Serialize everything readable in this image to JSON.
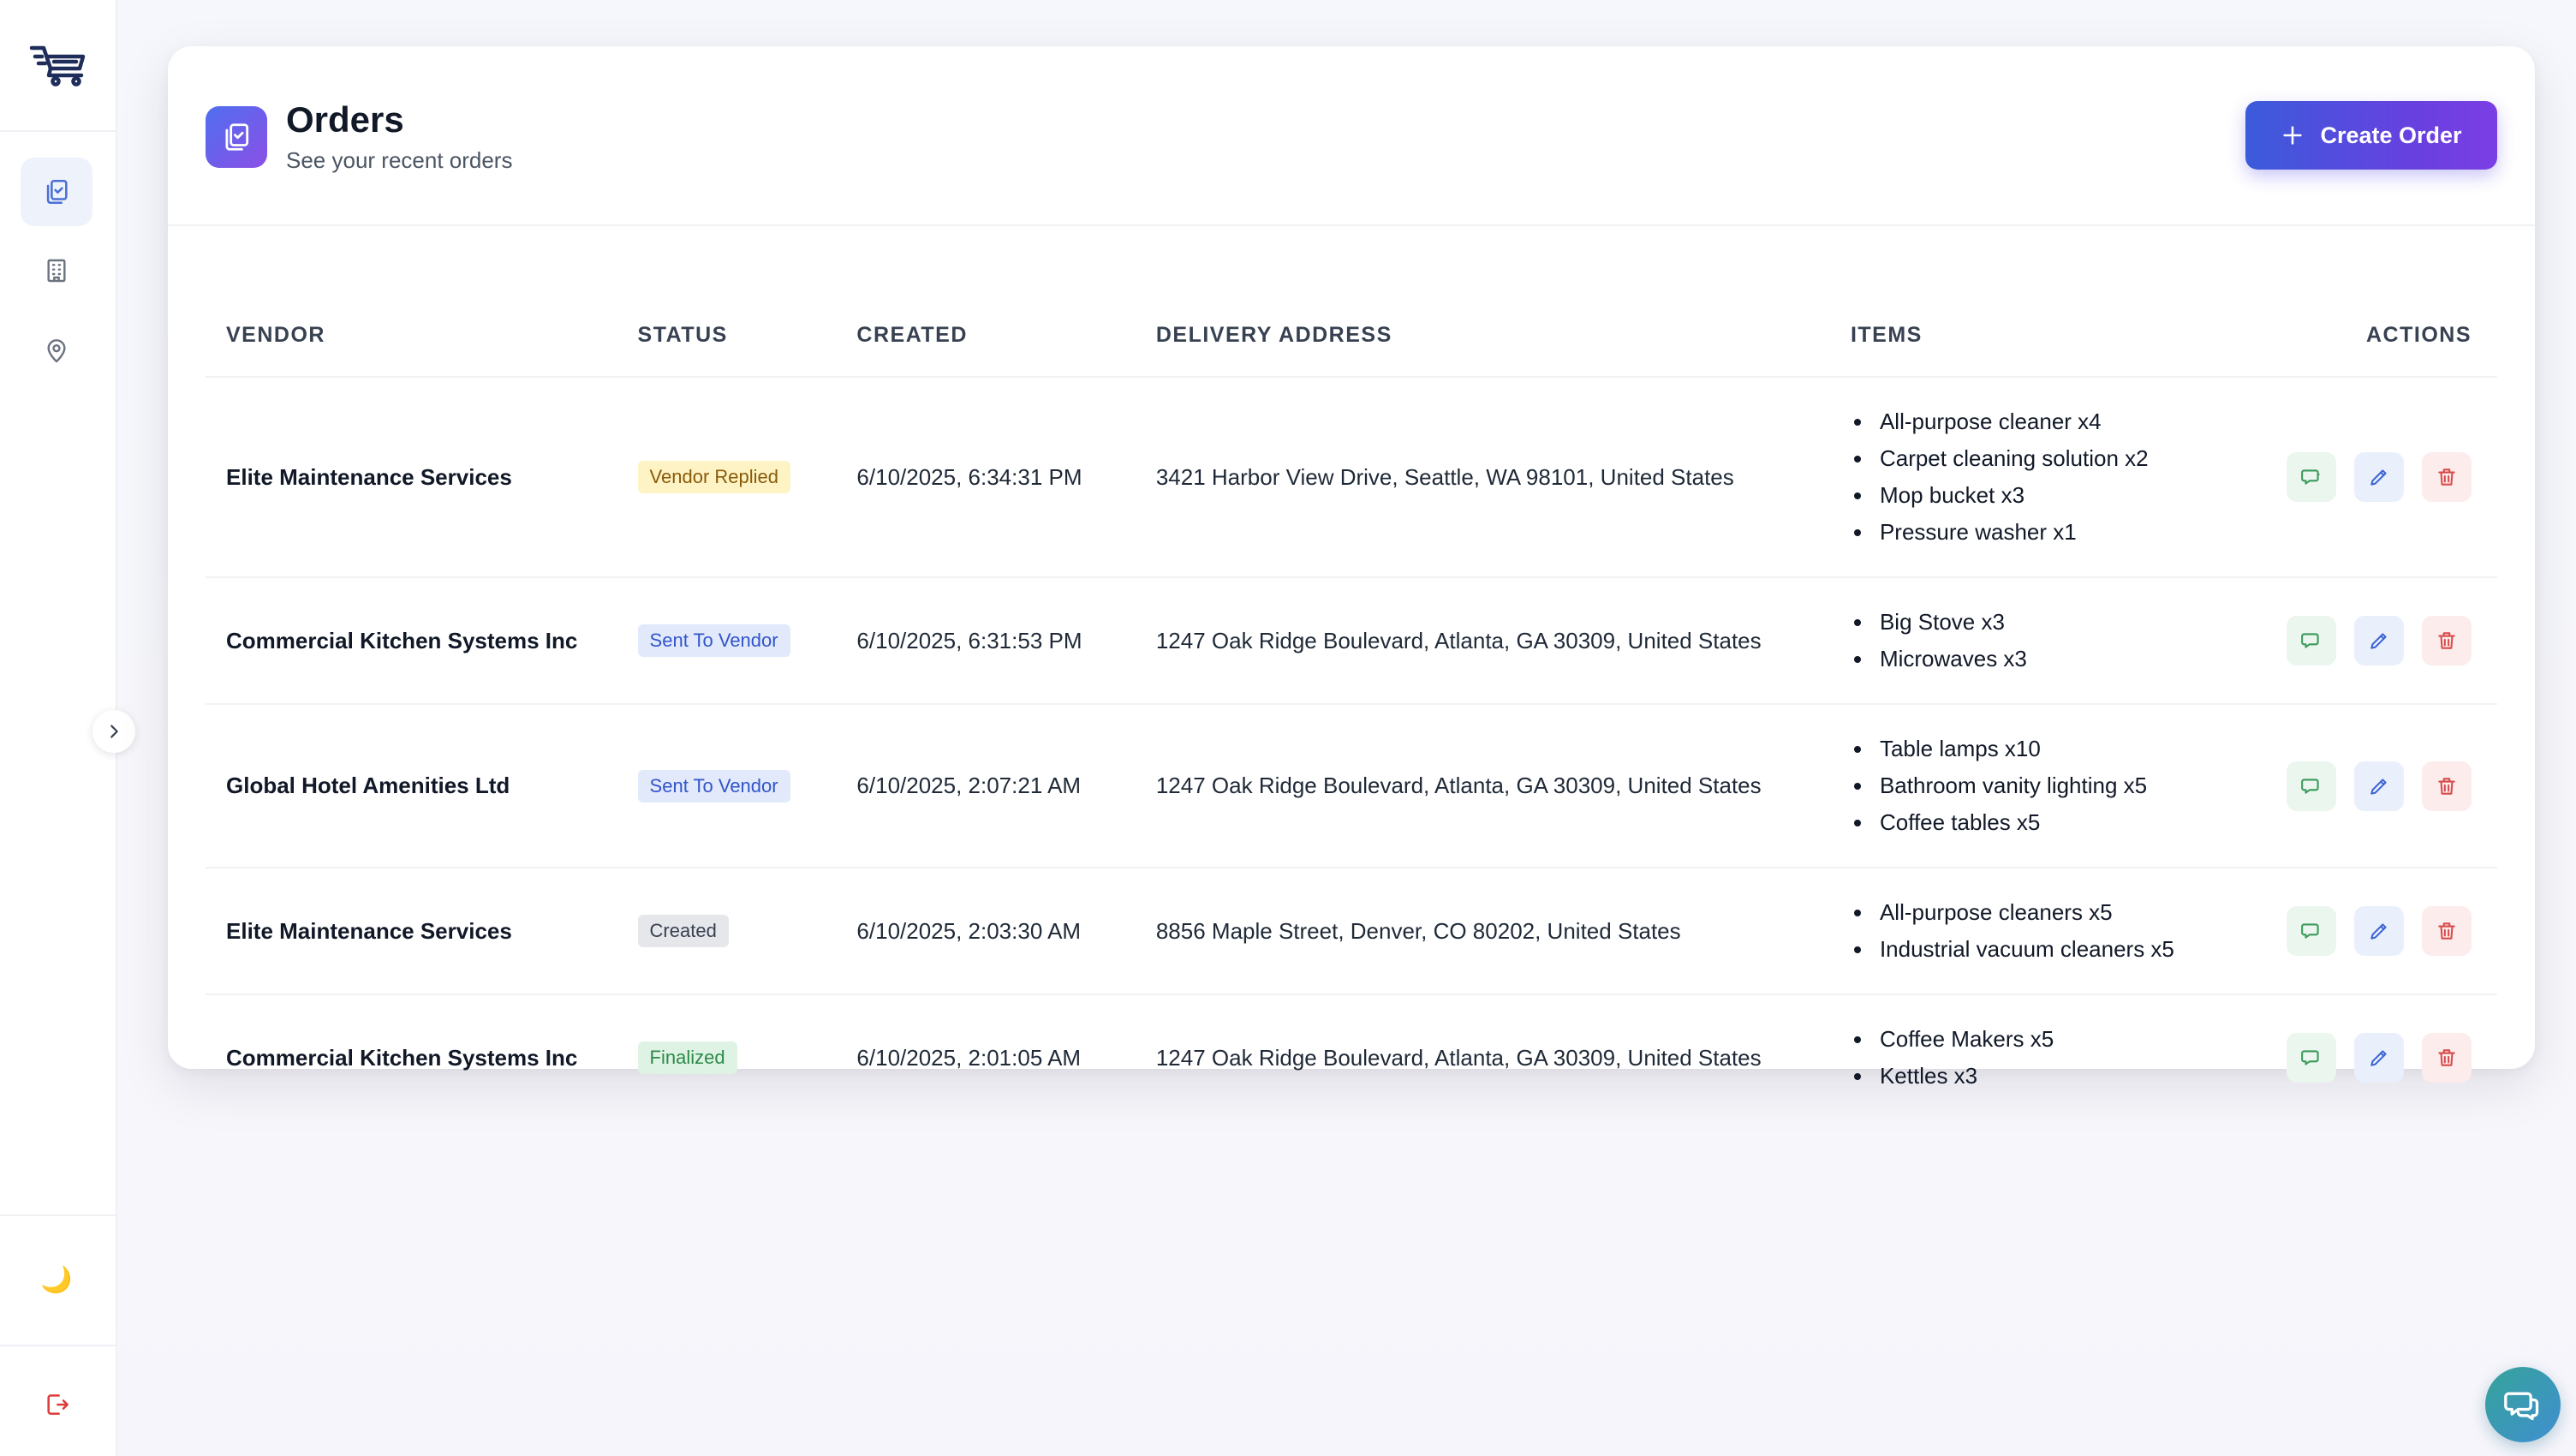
{
  "sidebar": {
    "logo_icon": "delivery-cart-icon",
    "nav": [
      {
        "name": "orders",
        "icon": "clipboard-check-icon",
        "active": true
      },
      {
        "name": "buildings",
        "icon": "building-icon",
        "active": false
      },
      {
        "name": "locations",
        "icon": "map-pin-icon",
        "active": false
      }
    ],
    "theme_icon": "🌙",
    "logout_icon": "logout-icon"
  },
  "header": {
    "title": "Orders",
    "subtitle": "See your recent orders",
    "create_label": "Create Order"
  },
  "table": {
    "columns": [
      "VENDOR",
      "STATUS",
      "CREATED",
      "DELIVERY ADDRESS",
      "ITEMS",
      "ACTIONS"
    ],
    "rows": [
      {
        "vendor": "Elite Maintenance Services",
        "status": "Vendor Replied",
        "created": "6/10/2025, 6:34:31 PM",
        "address": "3421 Harbor View Drive, Seattle, WA 98101, United States",
        "items": [
          "All-purpose cleaner x4",
          "Carpet cleaning solution x2",
          "Mop bucket x3",
          "Pressure washer x1"
        ]
      },
      {
        "vendor": "Commercial Kitchen Systems Inc",
        "status": "Sent To Vendor",
        "created": "6/10/2025, 6:31:53 PM",
        "address": "1247 Oak Ridge Boulevard, Atlanta, GA 30309, United States",
        "items": [
          "Big Stove x3",
          "Microwaves x3"
        ]
      },
      {
        "vendor": "Global Hotel Amenities Ltd",
        "status": "Sent To Vendor",
        "created": "6/10/2025, 2:07:21 AM",
        "address": "1247 Oak Ridge Boulevard, Atlanta, GA 30309, United States",
        "items": [
          "Table lamps x10",
          "Bathroom vanity lighting x5",
          "Coffee tables x5"
        ]
      },
      {
        "vendor": "Elite Maintenance Services",
        "status": "Created",
        "created": "6/10/2025, 2:03:30 AM",
        "address": "8856 Maple Street, Denver, CO 80202, United States",
        "items": [
          "All-purpose cleaners x5",
          "Industrial vacuum cleaners x5"
        ]
      },
      {
        "vendor": "Commercial Kitchen Systems Inc",
        "status": "Finalized",
        "created": "6/10/2025, 2:01:05 AM",
        "address": "1247 Oak Ridge Boulevard, Atlanta, GA 30309, United States",
        "items": [
          "Coffee Makers x5",
          "Kettles x3"
        ]
      }
    ]
  },
  "colors": {
    "accent_start": "#3b5bdb",
    "accent_end": "#7b3fe4",
    "status_vendor_replied": "#fdf3c4",
    "status_sent_to_vendor": "#e1e9fb",
    "status_created": "#e6e7ea",
    "status_finalized": "#dff3e4"
  }
}
